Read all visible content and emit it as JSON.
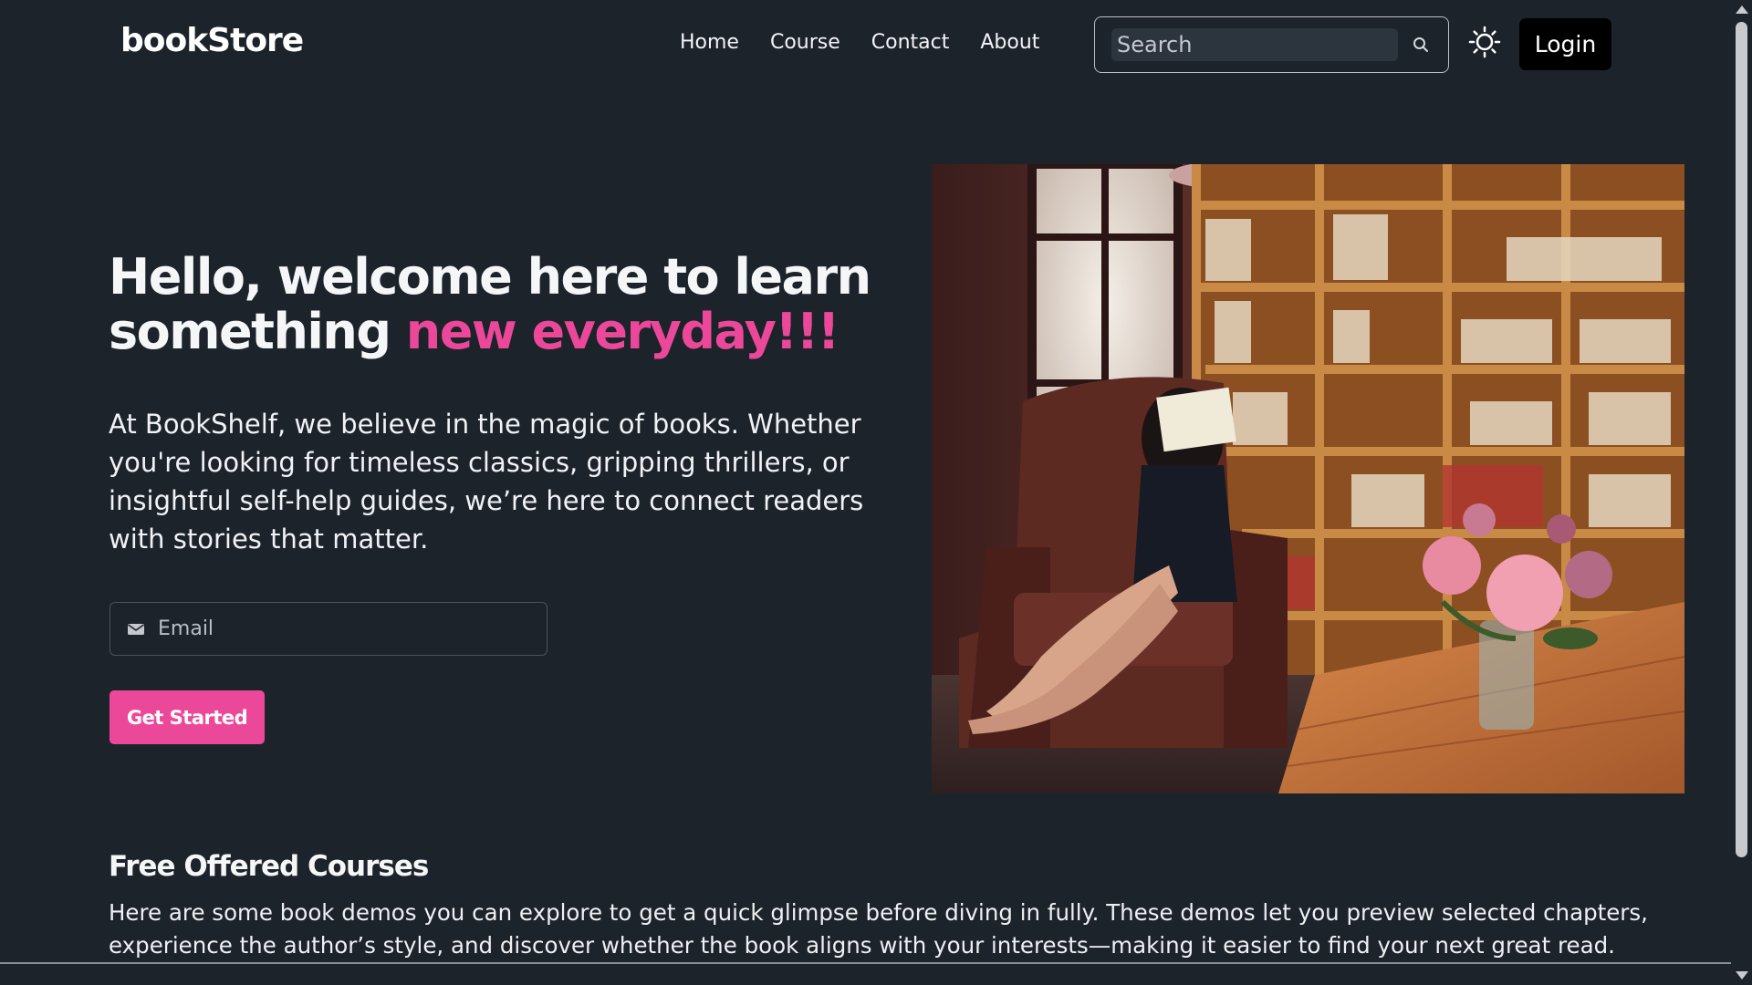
{
  "navbar": {
    "brand": "bookStore",
    "links": [
      "Home",
      "Course",
      "Contact",
      "About"
    ],
    "search_placeholder": "Search",
    "search_icon": "search-icon",
    "theme_icon": "sun-icon",
    "login_label": "Login"
  },
  "hero": {
    "title_line1": "Hello, welcome here to learn",
    "title_line2_plain": "something ",
    "title_line2_accent": "new everyday!!!",
    "description": "At BookShelf, we believe in the magic of books. Whether you're looking for timeless classics, gripping thrillers, or insightful self-help guides, we’re here to connect readers with stories that matter.",
    "email_placeholder": "Email",
    "email_icon": "envelope-icon",
    "cta_label": "Get Started",
    "image_alt": "woman-reading-in-library-photo"
  },
  "courses": {
    "title": "Free Offered Courses",
    "description": "Here are some book demos you can explore to get a quick glimpse before diving in fully. These demos let you preview selected chapters, experience the author’s style, and discover whether the book aligns with your interests—making it easier to find your next great read."
  },
  "colors": {
    "background": "#1d232a",
    "accent": "#ec4899",
    "login_bg": "#000000"
  }
}
